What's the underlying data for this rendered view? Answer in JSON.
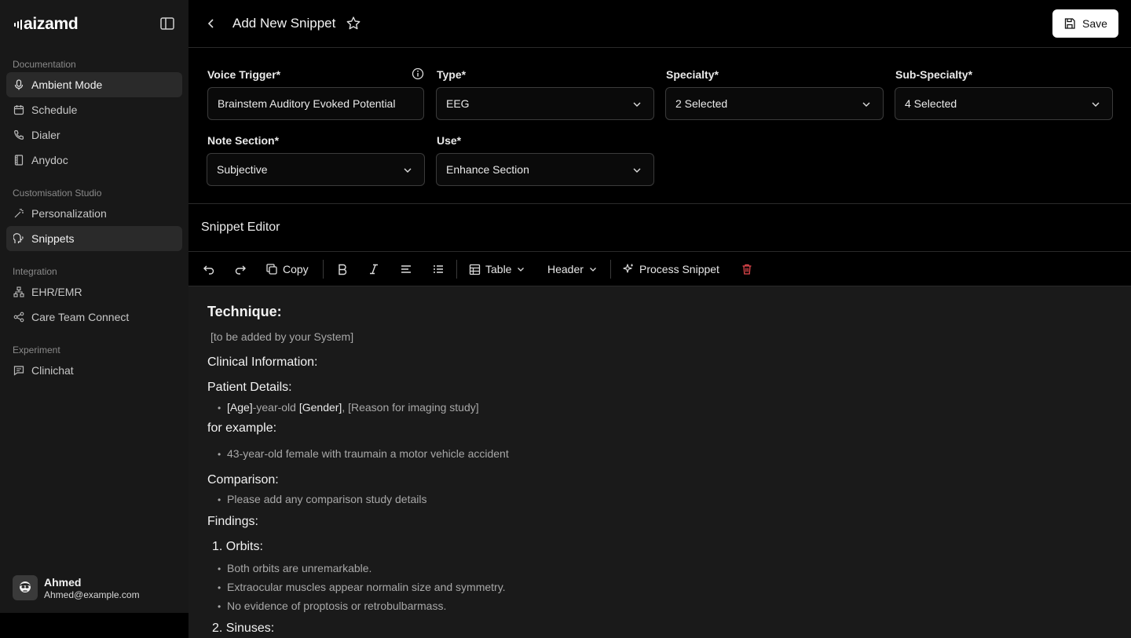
{
  "app": {
    "logo_text": "aizamd"
  },
  "sidebar": {
    "sections": [
      "Documentation",
      "Customisation Studio",
      "Integration",
      "Experiment"
    ],
    "items": [
      {
        "label": "Ambient Mode",
        "icon": "mic-icon",
        "active": true
      },
      {
        "label": "Schedule",
        "icon": "calendar-icon",
        "active": false
      },
      {
        "label": "Dialer",
        "icon": "phone-icon",
        "active": false
      },
      {
        "label": "Anydoc",
        "icon": "film-icon",
        "active": false
      },
      {
        "label": "Personalization",
        "icon": "magic-wand-icon",
        "active": false
      },
      {
        "label": "Snippets",
        "icon": "voice-head-icon",
        "active": true
      },
      {
        "label": "EHR/EMR",
        "icon": "network-icon",
        "active": false
      },
      {
        "label": "Care Team Connect",
        "icon": "share-icon",
        "active": false
      },
      {
        "label": "Clinichat",
        "icon": "chat-icon",
        "active": false
      }
    ],
    "user": {
      "name": "Ahmed",
      "email": "Ahmed@example.com"
    }
  },
  "header": {
    "title": "Add New Snippet",
    "save_label": "Save"
  },
  "form": {
    "voice_trigger": {
      "label": "Voice Trigger*",
      "value": "Brainstem Auditory Evoked Potential"
    },
    "type": {
      "label": "Type*",
      "value": "EEG"
    },
    "specialty": {
      "label": "Specialty*",
      "value": "2 Selected"
    },
    "sub_specialty": {
      "label": "Sub-Specialty*",
      "value": "4 Selected"
    },
    "note_section": {
      "label": "Note Section*",
      "value": "Subjective"
    },
    "use": {
      "label": "Use*",
      "value": "Enhance Section"
    }
  },
  "editor": {
    "title": "Snippet Editor",
    "toolbar": {
      "copy": "Copy",
      "table": "Table",
      "header": "Header",
      "process": "Process Snippet"
    },
    "content": {
      "technique_heading": "Technique:",
      "technique_text": "[to be added by your System]",
      "clinical_heading": "Clinical Information:",
      "patient_heading": "Patient Details:",
      "patient_age": "[Age]",
      "patient_mid": "-year-old ",
      "patient_gender": "[Gender]",
      "patient_reason": ", [Reason for imaging study]",
      "example_heading": "for example:",
      "example_text": "43-year-old female with traumain a motor vehicle accident",
      "comparison_heading": "Comparison:",
      "comparison_text": "Please add any comparison study details",
      "findings_heading": "Findings:",
      "orbits_heading": "1. Orbits:",
      "orbits_items": [
        "Both orbits are unremarkable.",
        "Extraocular muscles appear normalin size and symmetry.",
        "No evidence of proptosis or retrobulbarmass."
      ],
      "sinuses_heading": "2. Sinuses:"
    }
  }
}
